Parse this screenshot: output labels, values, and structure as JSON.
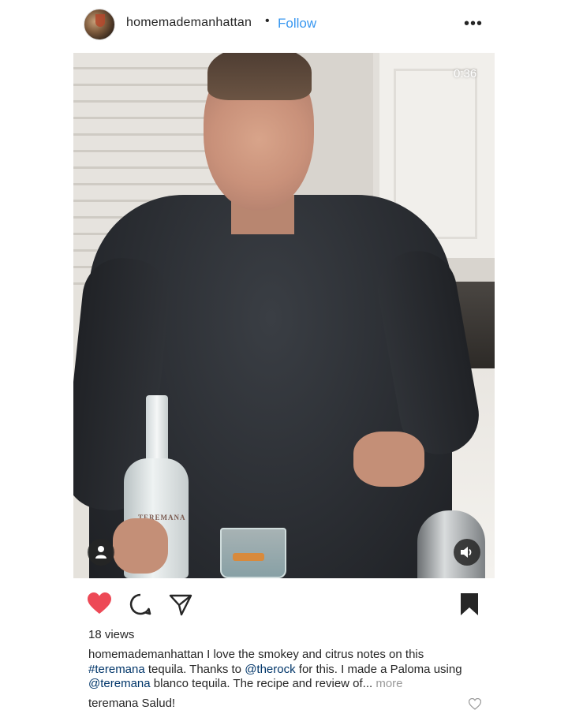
{
  "header": {
    "username": "homemademanhattan",
    "separator": "•",
    "follow_label": "Follow",
    "more_icon": "more-options-icon",
    "more_glyph": "•••"
  },
  "media": {
    "type": "video",
    "timestamp": "0:36",
    "bottle_label": "TEREMANA",
    "user_tag_icon": "user-tag-icon",
    "volume_icon": "volume-icon"
  },
  "actions": {
    "like_icon": "heart-icon",
    "liked": true,
    "like_color": "#ed4956",
    "comment_icon": "comment-icon",
    "share_icon": "direct-share-icon",
    "save_icon": "bookmark-icon",
    "saved": true
  },
  "stats": {
    "views": "18 views"
  },
  "caption": {
    "username": "homemademanhattan",
    "text_1": " I love the smokey and citrus notes on this ",
    "hashtag": "#teremana",
    "text_2": " tequila. Thanks to ",
    "mention_1": "@therock",
    "text_3": " for this. I made a Paloma using ",
    "mention_2": "@teremana",
    "text_4": " blanco tequila. The recipe and review of...",
    "more_label": " more"
  },
  "comments": [
    {
      "username": "teremana",
      "text": " Salud!"
    }
  ],
  "colors": {
    "follow": "#3897f0",
    "mention": "#003569",
    "text": "#262626",
    "muted": "#999999"
  }
}
